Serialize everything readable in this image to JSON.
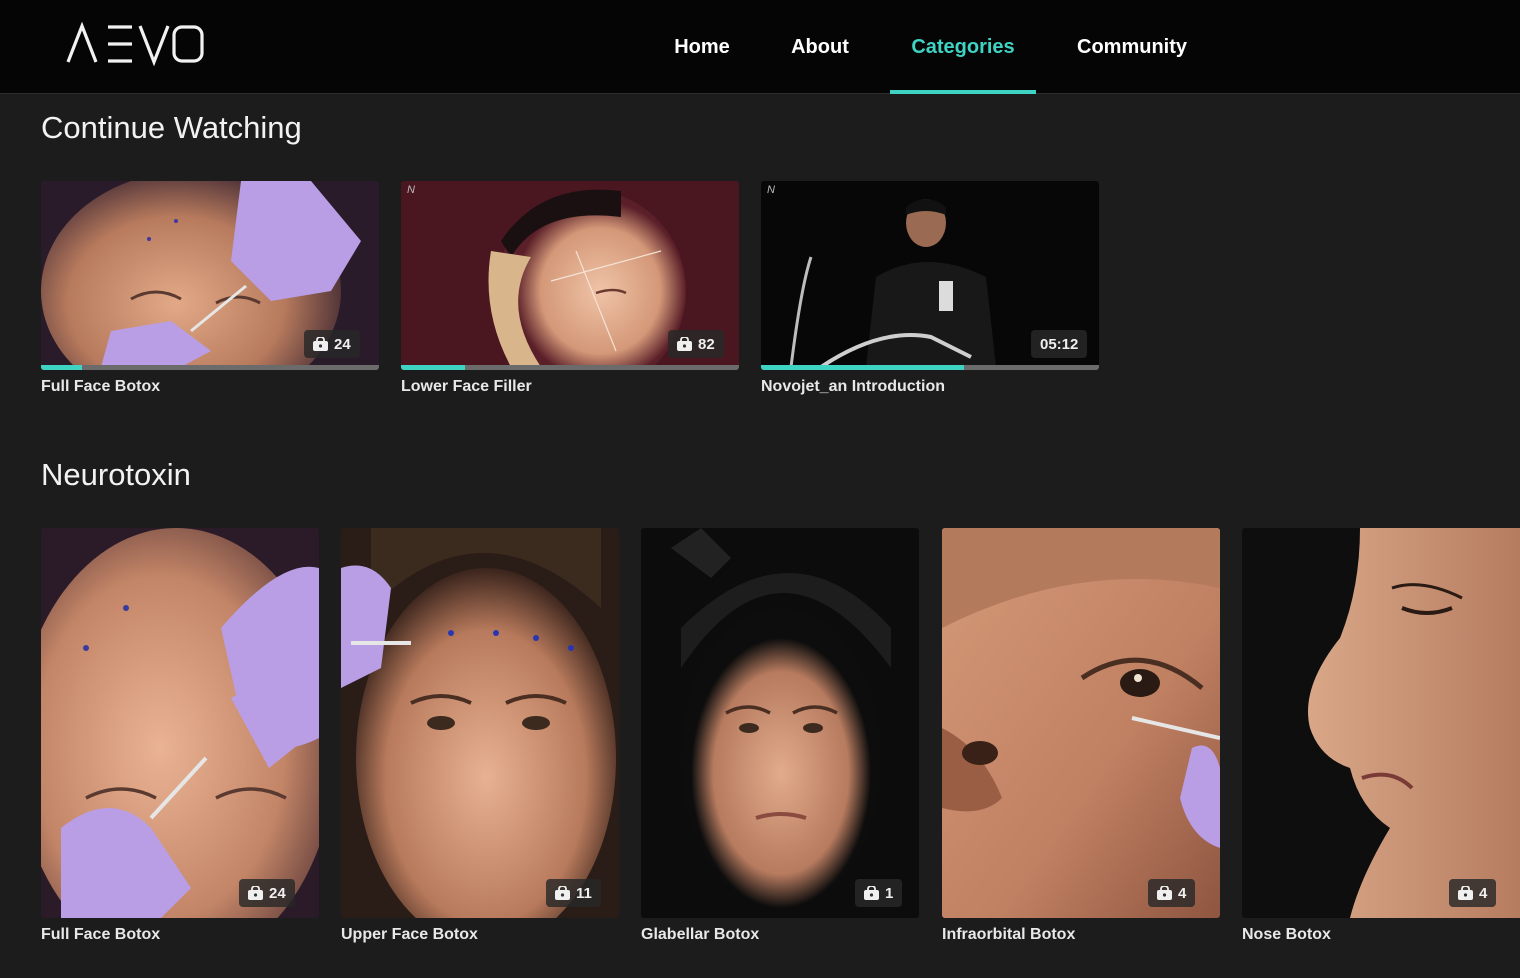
{
  "header": {
    "logo_text": "AEVO",
    "nav": [
      {
        "label": "Home",
        "active": false
      },
      {
        "label": "About",
        "active": false
      },
      {
        "label": "Categories",
        "active": true
      },
      {
        "label": "Community",
        "active": false
      }
    ]
  },
  "continue_watching": {
    "title": "Continue Watching",
    "items": [
      {
        "label": "Full Face Botox",
        "badge": "24",
        "badge_icon": "video-lock-icon",
        "progress": 0.12
      },
      {
        "label": "Lower Face Filler",
        "badge": "82",
        "badge_icon": "video-lock-icon",
        "progress": 0.19
      },
      {
        "label": "Novojet_an Introduction",
        "badge": "05:12",
        "badge_icon": "",
        "progress": 0.6
      }
    ]
  },
  "neurotoxin": {
    "title": "Neurotoxin",
    "items": [
      {
        "label": "Full Face Botox",
        "badge": "24",
        "badge_icon": "video-lock-icon"
      },
      {
        "label": "Upper Face Botox",
        "badge": "11",
        "badge_icon": "video-lock-icon"
      },
      {
        "label": "Glabellar Botox",
        "badge": "1",
        "badge_icon": "video-lock-icon"
      },
      {
        "label": "Infraorbital Botox",
        "badge": "4",
        "badge_icon": "video-lock-icon"
      },
      {
        "label": "Nose Botox",
        "badge": "4",
        "badge_icon": "video-lock-icon"
      }
    ]
  },
  "colors": {
    "accent": "#3fd3c4",
    "background": "#1c1c1c",
    "header": "#050505",
    "glove": "#b99ee6"
  }
}
